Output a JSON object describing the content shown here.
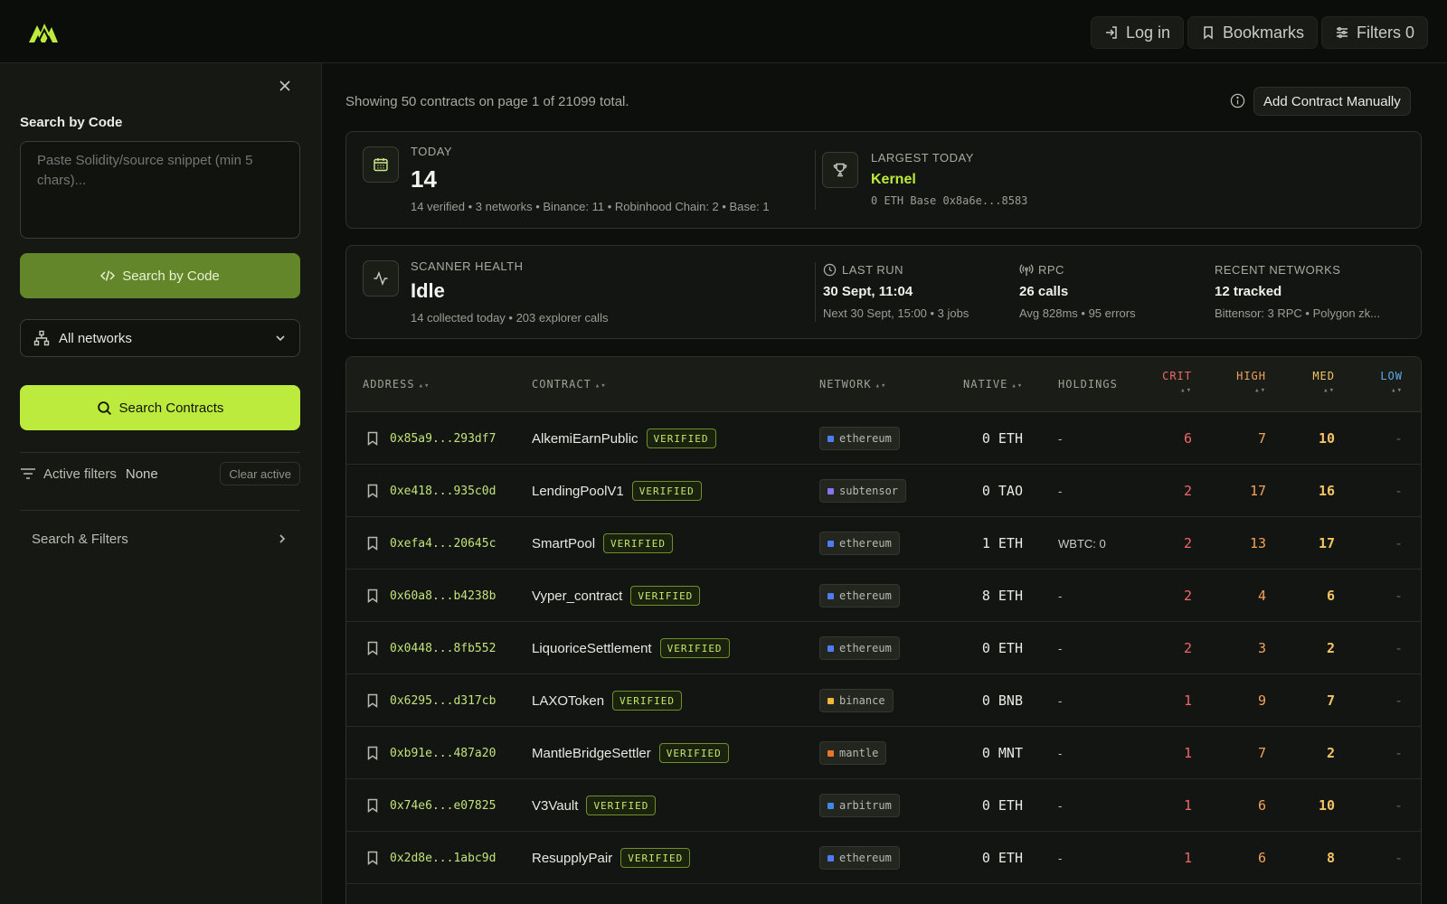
{
  "header": {
    "login_label": "Log in",
    "bookmarks_label": "Bookmarks",
    "filters_label": "Filters 0"
  },
  "sidebar": {
    "search_code_label": "Search by Code",
    "code_placeholder": "Paste Solidity/source snippet (min 5 chars)...",
    "search_code_button": "Search by Code",
    "network_select": "All networks",
    "search_contracts_button": "Search Contracts",
    "active_filters_label": "Active filters",
    "active_filters_value": "None",
    "clear_active": "Clear active",
    "search_filters_label": "Search & Filters"
  },
  "main": {
    "showing": "Showing 50 contracts on page 1 of 21099 total.",
    "add_manual": "Add Contract Manually"
  },
  "today_card": {
    "caption": "TODAY",
    "value": "14",
    "sub": "14 verified • 3 networks • Binance: 11 • Robinhood Chain: 2 • Base: 1",
    "largest_caption": "LARGEST TODAY",
    "largest_name": "Kernel",
    "largest_sub": "0 ETH  Base  0x8a6e...8583"
  },
  "health_card": {
    "caption": "SCANNER HEALTH",
    "value": "Idle",
    "sub": "14 collected today • 203 explorer calls",
    "last_run_caption": "LAST RUN",
    "last_run_value": "30 Sept, 11:04",
    "last_run_sub": "Next 30 Sept, 15:00 • 3 jobs",
    "rpc_caption": "RPC",
    "rpc_value": "26 calls",
    "rpc_sub": "Avg 828ms • 95 errors",
    "recent_caption": "RECENT NETWORKS",
    "recent_value": "12 tracked",
    "recent_sub": "Bittensor: 3 RPC • Polygon zk..."
  },
  "table": {
    "headers": {
      "address": "ADDRESS",
      "contract": "CONTRACT",
      "network": "NETWORK",
      "native": "NATIVE",
      "holdings": "HOLDINGS",
      "crit": "CRIT",
      "high": "HIGH",
      "med": "MED",
      "low": "LOW"
    },
    "verified_label": "VERIFIED",
    "rows": [
      {
        "address": "0x85a9...293df7",
        "contract": "AlkemiEarnPublic",
        "network": "ethereum",
        "native": "0 ETH",
        "holdings": "-",
        "crit": "6",
        "high": "7",
        "med": "10",
        "low": "-"
      },
      {
        "address": "0xe418...935c0d",
        "contract": "LendingPoolV1",
        "network": "subtensor",
        "native": "0 TAO",
        "holdings": "-",
        "crit": "2",
        "high": "17",
        "med": "16",
        "low": "-"
      },
      {
        "address": "0xefa4...20645c",
        "contract": "SmartPool",
        "network": "ethereum",
        "native": "1 ETH",
        "holdings": "WBTC: 0",
        "crit": "2",
        "high": "13",
        "med": "17",
        "low": "-"
      },
      {
        "address": "0x60a8...b4238b",
        "contract": "Vyper_contract",
        "network": "ethereum",
        "native": "8 ETH",
        "holdings": "-",
        "crit": "2",
        "high": "4",
        "med": "6",
        "low": "-"
      },
      {
        "address": "0x0448...8fb552",
        "contract": "LiquoriceSettlement",
        "network": "ethereum",
        "native": "0 ETH",
        "holdings": "-",
        "crit": "2",
        "high": "3",
        "med": "2",
        "low": "-"
      },
      {
        "address": "0x6295...d317cb",
        "contract": "LAXOToken",
        "network": "binance",
        "native": "0 BNB",
        "holdings": "-",
        "crit": "1",
        "high": "9",
        "med": "7",
        "low": "-"
      },
      {
        "address": "0xb91e...487a20",
        "contract": "MantleBridgeSettler",
        "network": "mantle",
        "native": "0 MNT",
        "holdings": "-",
        "crit": "1",
        "high": "7",
        "med": "2",
        "low": "-"
      },
      {
        "address": "0x74e6...e07825",
        "contract": "V3Vault",
        "network": "arbitrum",
        "native": "0 ETH",
        "holdings": "-",
        "crit": "1",
        "high": "6",
        "med": "10",
        "low": "-"
      },
      {
        "address": "0x2d8e...1abc9d",
        "contract": "ResupplyPair",
        "network": "ethereum",
        "native": "0 ETH",
        "holdings": "-",
        "crit": "1",
        "high": "6",
        "med": "8",
        "low": "-"
      }
    ]
  },
  "colors": {
    "accent": "#bdeb3d",
    "crit": "#f0676b",
    "high": "#f2a35b",
    "med": "#f4c465",
    "low": "#5fa8e8",
    "ethereum": "#4f7cf2",
    "subtensor": "#8a72f0",
    "binance": "#f0b83a",
    "mantle": "#e8742a",
    "arbitrum": "#3f88e8"
  },
  "icons": {
    "logo": "mountain-logo",
    "login": "login-icon",
    "bookmarks": "bookmark-icon",
    "filters": "sliders-icon",
    "close": "close-icon",
    "code": "code-icon",
    "network": "network-icon",
    "search": "search-icon",
    "filter": "filter-icon",
    "calendar": "calendar-icon",
    "trophy": "trophy-icon",
    "activity": "activity-icon",
    "clock": "clock-icon",
    "rpc": "antenna-icon",
    "info": "info-icon"
  }
}
